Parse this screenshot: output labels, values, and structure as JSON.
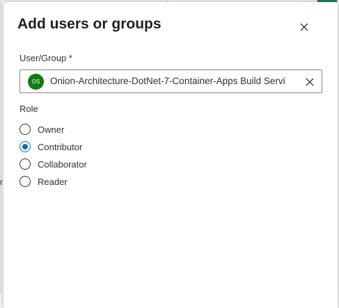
{
  "dialog": {
    "title": "Add users or groups",
    "close_icon": "close-icon"
  },
  "user_group": {
    "label": "User/Group *",
    "selected": {
      "initials": "OS",
      "avatar_color": "#107c10",
      "name": "Onion-Architecture-DotNet-7-Container-Apps Build Servi",
      "remove_icon": "close-icon"
    }
  },
  "role": {
    "label": "Role",
    "options": [
      {
        "label": "Owner",
        "checked": false
      },
      {
        "label": "Contributor",
        "checked": true
      },
      {
        "label": "Collaborator",
        "checked": false
      },
      {
        "label": "Reader",
        "checked": false
      }
    ],
    "accent_color": "#0f6cbd"
  },
  "background": {
    "edge_fragment": "r"
  }
}
